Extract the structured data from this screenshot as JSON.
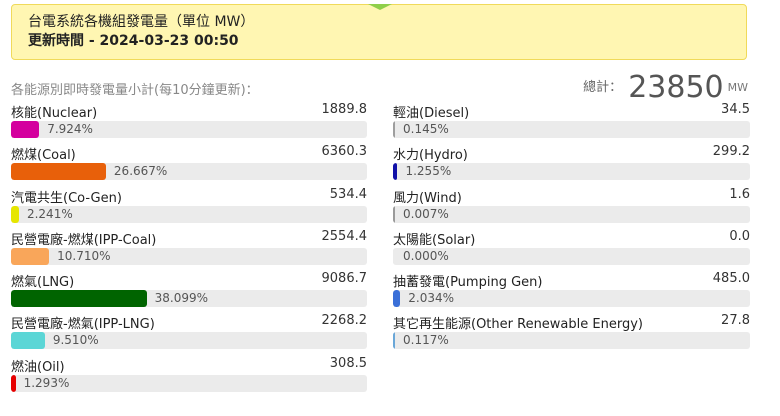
{
  "header": {
    "title": "台電系統各機組發電量（單位 MW）",
    "update_label": "更新時間 - 2024-03-23 00:50"
  },
  "subtitle": "各能源別即時發電量小計(每10分鐘更新)：",
  "total": {
    "label": "總計：",
    "value": "23850",
    "unit": "MW"
  },
  "left": [
    {
      "name": "核能(Nuclear)",
      "value": "1889.8",
      "pct_text": "7.924%",
      "pct": 7.924,
      "color": "#d4009e"
    },
    {
      "name": "燃煤(Coal)",
      "value": "6360.3",
      "pct_text": "26.667%",
      "pct": 26.667,
      "color": "#e8600a"
    },
    {
      "name": "汽電共生(Co-Gen)",
      "value": "534.4",
      "pct_text": "2.241%",
      "pct": 2.241,
      "color": "#e6e600"
    },
    {
      "name": "民營電廠-燃煤(IPP-Coal)",
      "value": "2554.4",
      "pct_text": "10.710%",
      "pct": 10.71,
      "color": "#f9a65a"
    },
    {
      "name": "燃氣(LNG)",
      "value": "9086.7",
      "pct_text": "38.099%",
      "pct": 38.099,
      "color": "#006400"
    },
    {
      "name": "民營電廠-燃氣(IPP-LNG)",
      "value": "2268.2",
      "pct_text": "9.510%",
      "pct": 9.51,
      "color": "#5bd6d6"
    },
    {
      "name": "燃油(Oil)",
      "value": "308.5",
      "pct_text": "1.293%",
      "pct": 1.293,
      "color": "#e60000"
    }
  ],
  "right": [
    {
      "name": "輕油(Diesel)",
      "value": "34.5",
      "pct_text": "0.145%",
      "pct": 0.145,
      "color": "#9e9e9e"
    },
    {
      "name": "水力(Hydro)",
      "value": "299.2",
      "pct_text": "1.255%",
      "pct": 1.255,
      "color": "#1010a8"
    },
    {
      "name": "風力(Wind)",
      "value": "1.6",
      "pct_text": "0.007%",
      "pct": 0.007,
      "color": "#9a9a9a"
    },
    {
      "name": "太陽能(Solar)",
      "value": "0.0",
      "pct_text": "0.000%",
      "pct": 0.0,
      "color": "#ebebeb"
    },
    {
      "name": "抽蓄發電(Pumping Gen)",
      "value": "485.0",
      "pct_text": "2.034%",
      "pct": 2.034,
      "color": "#3a6fd8"
    },
    {
      "name": "其它再生能源(Other Renewable Energy)",
      "value": "27.8",
      "pct_text": "0.117%",
      "pct": 0.117,
      "color": "#6aa7d8"
    }
  ]
}
